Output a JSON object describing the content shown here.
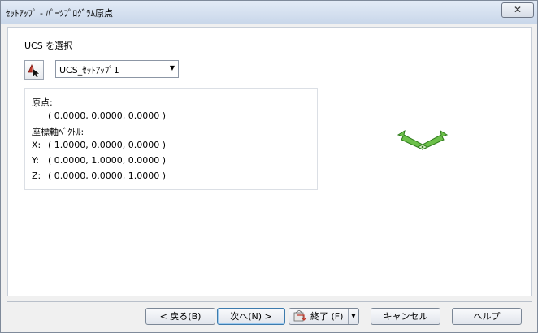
{
  "window": {
    "title": "ｾｯﾄｱｯﾌﾟ - ﾊﾟｰﾂﾌﾟﾛｸﾞﾗﾑ原点",
    "close_glyph": "✕"
  },
  "ucs": {
    "label": "UCS を選択",
    "pick_icon": "pick-point-icon",
    "selected": "UCS_ｾｯﾄｱｯﾌﾟ1",
    "dropdown_arrow": "▼"
  },
  "info": {
    "origin_label": "原点:",
    "origin_value": "( 0.0000, 0.0000, 0.0000 )",
    "vector_label": "座標軸ﾍﾞｸﾄﾙ:",
    "x_label": "X:",
    "x_value": "( 1.0000, 0.0000, 0.0000 )",
    "y_label": "Y:",
    "y_value": "( 0.0000, 1.0000, 0.0000 )",
    "z_label": "Z:",
    "z_value": "( 0.0000, 0.0000, 1.0000 )"
  },
  "graphic": {
    "icon": "ucs-axes-icon",
    "color": "#4caf32"
  },
  "buttons": {
    "back": "< 戻る(B)",
    "next": "次へ(N) >",
    "finish": "終了 (F)",
    "finish_drop": "▼",
    "cancel": "キャンセル",
    "help": "ヘルプ"
  }
}
